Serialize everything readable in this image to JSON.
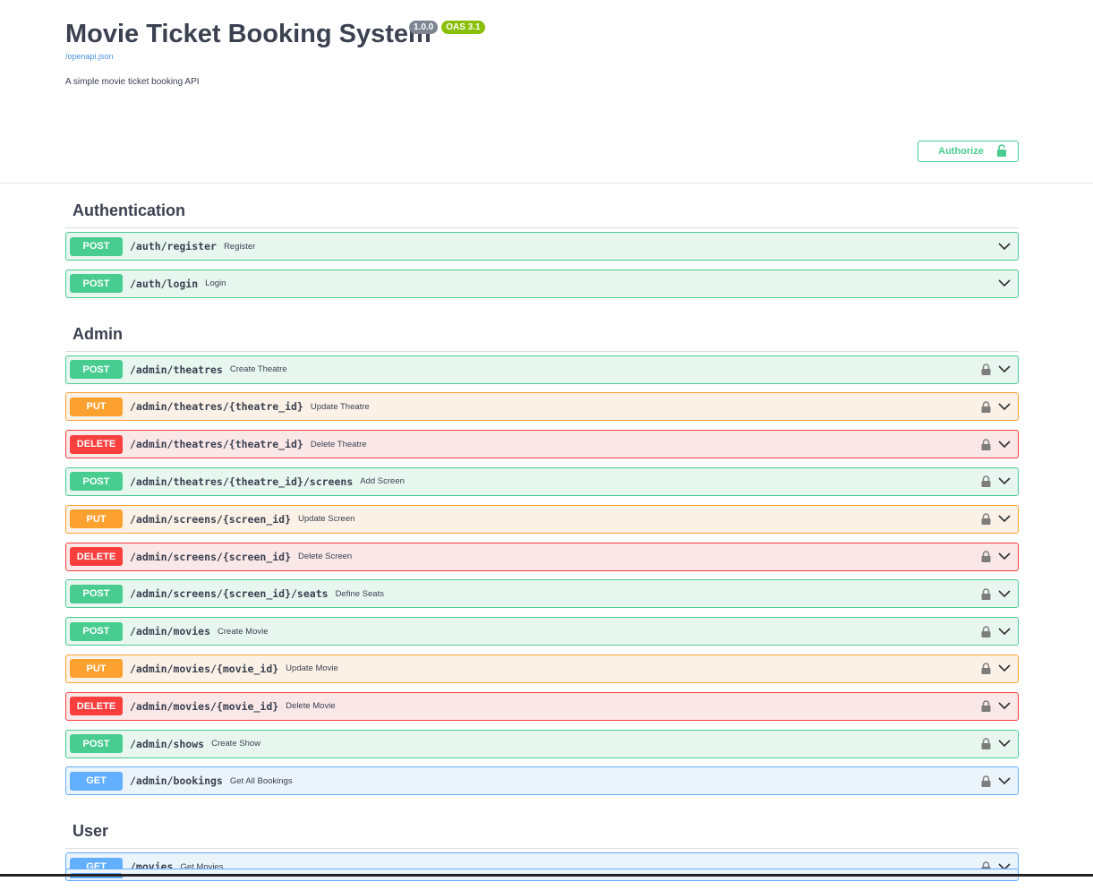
{
  "header": {
    "title": "Movie Ticket Booking System",
    "version_badge": "1.0.0",
    "oas_badge": "OAS 3.1",
    "spec_link": "/openapi.json",
    "description": "A simple movie ticket booking API",
    "authorize_label": "Authorize"
  },
  "colors": {
    "post": "#49cc90",
    "put": "#fca130",
    "delete": "#f93e3e",
    "get": "#61affe"
  },
  "tags": [
    {
      "name": "Authentication",
      "operations": [
        {
          "method": "POST",
          "path": "/auth/register",
          "summary": "Register",
          "locked": false
        },
        {
          "method": "POST",
          "path": "/auth/login",
          "summary": "Login",
          "locked": false
        }
      ]
    },
    {
      "name": "Admin",
      "operations": [
        {
          "method": "POST",
          "path": "/admin/theatres",
          "summary": "Create Theatre",
          "locked": true
        },
        {
          "method": "PUT",
          "path": "/admin/theatres/{theatre_id}",
          "summary": "Update Theatre",
          "locked": true
        },
        {
          "method": "DELETE",
          "path": "/admin/theatres/{theatre_id}",
          "summary": "Delete Theatre",
          "locked": true
        },
        {
          "method": "POST",
          "path": "/admin/theatres/{theatre_id}/screens",
          "summary": "Add Screen",
          "locked": true
        },
        {
          "method": "PUT",
          "path": "/admin/screens/{screen_id}",
          "summary": "Update Screen",
          "locked": true
        },
        {
          "method": "DELETE",
          "path": "/admin/screens/{screen_id}",
          "summary": "Delete Screen",
          "locked": true
        },
        {
          "method": "POST",
          "path": "/admin/screens/{screen_id}/seats",
          "summary": "Define Seats",
          "locked": true
        },
        {
          "method": "POST",
          "path": "/admin/movies",
          "summary": "Create Movie",
          "locked": true
        },
        {
          "method": "PUT",
          "path": "/admin/movies/{movie_id}",
          "summary": "Update Movie",
          "locked": true
        },
        {
          "method": "DELETE",
          "path": "/admin/movies/{movie_id}",
          "summary": "Delete Movie",
          "locked": true
        },
        {
          "method": "POST",
          "path": "/admin/shows",
          "summary": "Create Show",
          "locked": true
        },
        {
          "method": "GET",
          "path": "/admin/bookings",
          "summary": "Get All Bookings",
          "locked": true
        }
      ]
    },
    {
      "name": "User",
      "operations": [
        {
          "method": "GET",
          "path": "/movies",
          "summary": "Get Movies",
          "locked": true
        }
      ]
    }
  ]
}
